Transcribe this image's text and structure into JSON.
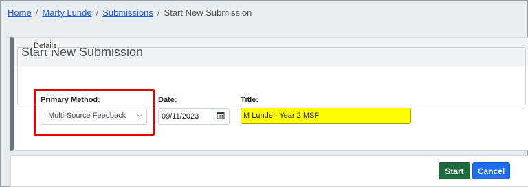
{
  "breadcrumb": {
    "items": [
      "Home",
      "Marty Lunde",
      "Submissions"
    ],
    "current": "Start New Submission",
    "separator": "/"
  },
  "panel": {
    "title": "Start New Submission"
  },
  "details": {
    "legend": "Details",
    "primary_method": {
      "label": "Primary Method:",
      "selected": "Multi-Source Feedback"
    },
    "date": {
      "label": "Date:",
      "value": "09/11/2023"
    },
    "title": {
      "label": "Title:",
      "value": "M Lunde - Year 2 MSF"
    }
  },
  "actions": {
    "start_label": "Start",
    "cancel_label": "Cancel"
  },
  "colors": {
    "highlight_border": "#e00000",
    "title_field_bg": "#ffff00",
    "start_button": "#1e6b3f",
    "cancel_button": "#1d6ff0"
  }
}
